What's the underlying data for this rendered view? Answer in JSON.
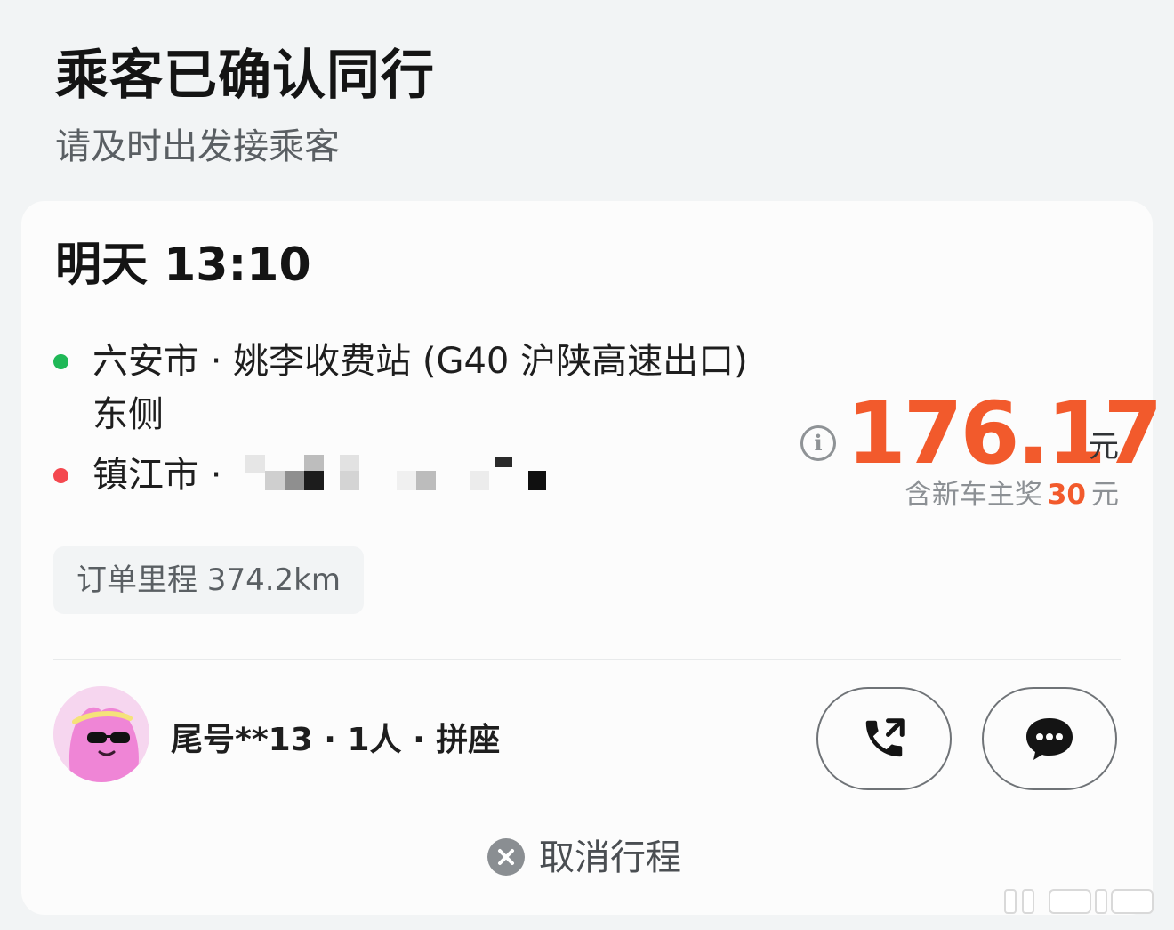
{
  "header": {
    "title": "乘客已确认同行",
    "subtitle": "请及时出发接乘客"
  },
  "trip": {
    "time": "明天 13:10",
    "origin": {
      "city": "六安市",
      "separator": " · ",
      "detail": "姚李收费站 (G40 沪陕高速出口) 东侧"
    },
    "destination": {
      "city": "镇江市",
      "separator": " · "
    },
    "distance": "订单里程 374.2km"
  },
  "price": {
    "value": "176.17",
    "unit": "元",
    "bonus_prefix": "含新车主奖",
    "bonus_amount": "30",
    "bonus_unit": "元"
  },
  "passenger": {
    "info": "尾号**13 · 1人 · 拼座"
  },
  "actions": {
    "cancel_label": "取消行程"
  },
  "colors": {
    "accent": "#f25a2c",
    "origin_dot": "#1fb857",
    "destination_dot": "#f4484f"
  },
  "icons": {
    "info": "info-icon",
    "call": "phone-call-icon",
    "message": "chat-bubble-icon",
    "cancel": "close-circle-icon"
  }
}
